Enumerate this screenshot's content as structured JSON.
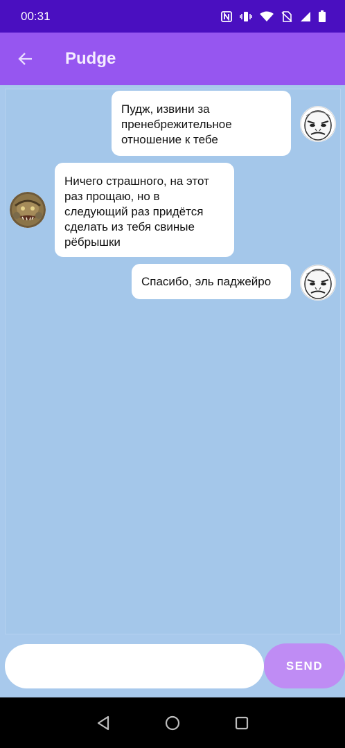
{
  "status_bar": {
    "time": "00:31",
    "icons": [
      "nfc-icon",
      "vibrate-icon",
      "wifi-icon",
      "no-sim-icon",
      "signal-icon",
      "battery-icon"
    ]
  },
  "app_bar": {
    "title": "Pudge",
    "back_icon": "arrow-back-icon"
  },
  "messages": [
    {
      "sender": "self",
      "avatar": "rage-face-avatar",
      "text": "Пудж, извини за пренебрежительное отношение к тебе"
    },
    {
      "sender": "pudge",
      "avatar": "pudge-avatar",
      "text": "Ничего страшного, на этот раз прощаю, но в следующий раз придётся сделать из тебя свиные рёбрышки"
    },
    {
      "sender": "self",
      "avatar": "rage-face-avatar",
      "text": "Спасибо, эль паджейро"
    }
  ],
  "input": {
    "value": "",
    "send_label": "SEND"
  },
  "nav_bar": {
    "icons": [
      "back-triangle-icon",
      "home-circle-icon",
      "recents-square-icon"
    ]
  },
  "colors": {
    "status_bar": "#4a0fc0",
    "app_bar": "#9656f0",
    "chat_background": "#a4c7ea",
    "send_button": "#bf8cf4"
  }
}
